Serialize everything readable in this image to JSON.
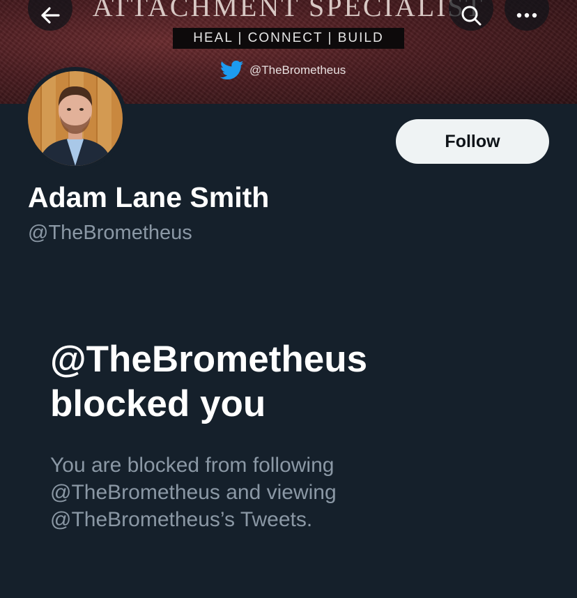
{
  "banner": {
    "title": "ATTACHMENT SPECIALIST",
    "tagline": "HEAL | CONNECT | BUILD",
    "twitter_handle": "@TheBrometheus",
    "colors": {
      "background": "#4a1c20",
      "twitter_blue": "#1d9bf0"
    }
  },
  "header": {
    "back_icon": "arrow-left-icon",
    "search_icon": "search-icon",
    "more_icon": "more-horizontal-icon"
  },
  "profile": {
    "display_name": "Adam Lane Smith",
    "username": "@TheBrometheus",
    "follow_label": "Follow"
  },
  "blocked": {
    "title_line1": "@TheBrometheus",
    "title_line2": "blocked you",
    "desc_line1": "You are blocked from following",
    "desc_line2": "@TheBrometheus and viewing",
    "desc_line3": "@TheBrometheus’s Tweets."
  },
  "colors": {
    "background": "#15202b",
    "secondary_text": "#8b98a5",
    "button_bg": "#eff3f4"
  }
}
